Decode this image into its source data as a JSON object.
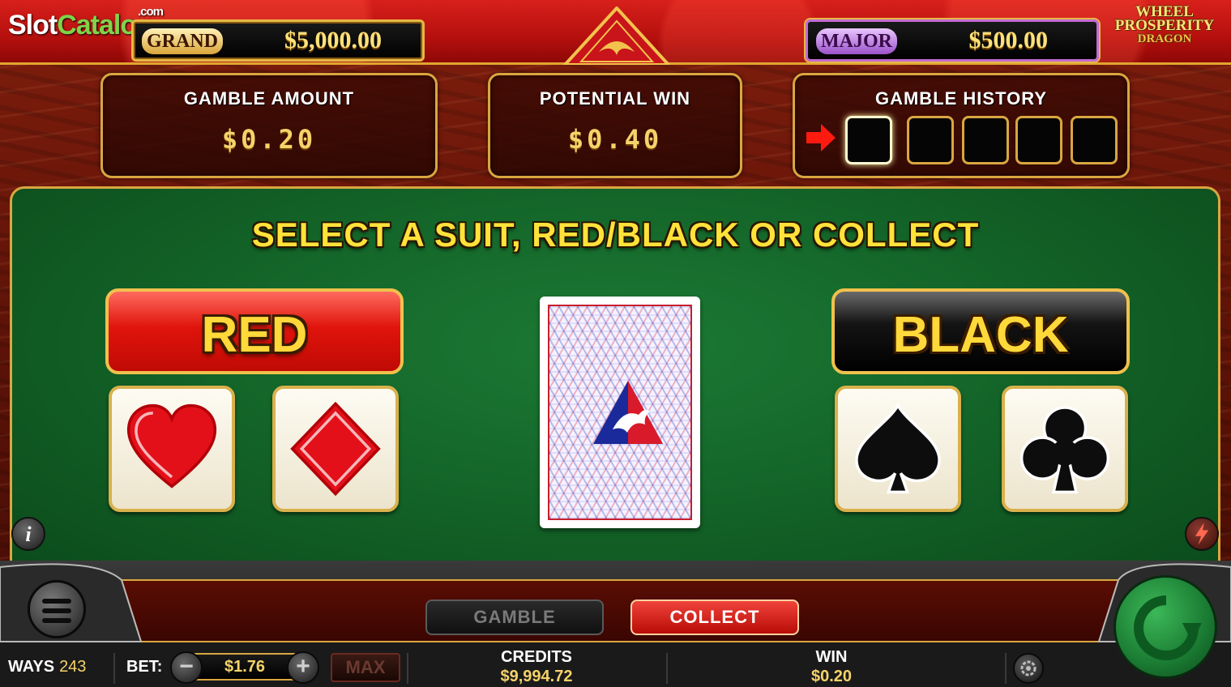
{
  "watermark": {
    "brand_a": "Slot",
    "brand_b": "Catalog",
    "suffix": ".com"
  },
  "jackpots": {
    "grand": {
      "label": "GRAND",
      "value": "$5,000.00"
    },
    "major": {
      "label": "MAJOR",
      "value": "$500.00"
    }
  },
  "logo": {
    "line1": "WHEEL",
    "line2": "PROSPERITY",
    "line3": "DRAGON"
  },
  "gamble_amount": {
    "title": "GAMBLE  AMOUNT",
    "value": "$0.20"
  },
  "potential_win": {
    "title": "POTENTIAL  WIN",
    "value": "$0.40"
  },
  "gamble_history": {
    "title": "GAMBLE  HISTORY",
    "slots": 5
  },
  "instruction": "SELECT A SUIT, RED/BLACK OR COLLECT",
  "color_buttons": {
    "red": "RED",
    "black": "BLACK"
  },
  "suits": [
    "heart",
    "diamond",
    "spade",
    "club"
  ],
  "info_button": "i",
  "actions": {
    "gamble": "GAMBLE",
    "collect": "COLLECT"
  },
  "status": {
    "ways_label": "WAYS",
    "ways_value": "243",
    "bet_label": "BET:",
    "bet_value": "$1.76",
    "max_label": "MAX",
    "credits_label": "CREDITS",
    "credits_value": "$9,994.72",
    "win_label": "WIN",
    "win_value": "$0.20"
  },
  "colors": {
    "felt": "#136328",
    "gold": "#d9a640",
    "red": "#e0140c",
    "yellow_text": "#ffe23a"
  }
}
